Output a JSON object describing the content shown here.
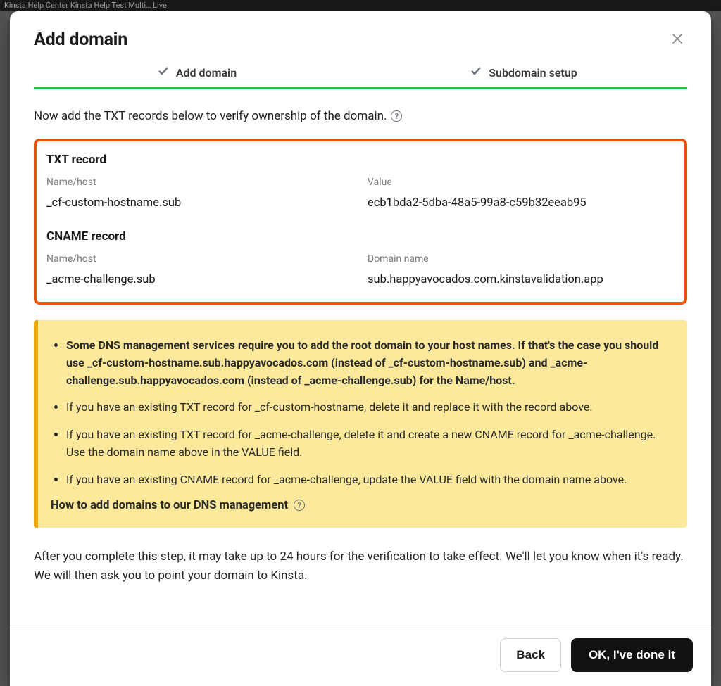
{
  "browser_tab_hint": "Kinsta Help Center     Kinsta Help Test Multi…     Live",
  "modal": {
    "title": "Add domain",
    "steps": [
      {
        "label": "Add domain"
      },
      {
        "label": "Subdomain setup"
      }
    ],
    "intro": "Now add the TXT records below to verify ownership of the domain.",
    "records": {
      "txt": {
        "title": "TXT record",
        "name_label": "Name/host",
        "name_value": "_cf-custom-hostname.sub",
        "value_label": "Value",
        "value_value": "ecb1bda2-5dba-48a5-99a8-c59b32eeab95"
      },
      "cname": {
        "title": "CNAME record",
        "name_label": "Name/host",
        "name_value": "_acme-challenge.sub",
        "value_label": "Domain name",
        "value_value": "sub.happyavocados.com.kinstavalidation.app"
      }
    },
    "notice": {
      "bold_item": {
        "a": "Some DNS management services require you to add the root domain to your host names. If that's the case you should use ",
        "b": "_cf-custom-hostname.sub.happyavocados.com",
        "c": " (instead of _cf-custom-hostname.sub) and ",
        "d": "_acme-challenge.sub.happyavocados.com",
        "e": " (instead of _acme-challenge.sub) for the Name/host."
      },
      "items": [
        "If you have an existing TXT record for _cf-custom-hostname, delete it and replace it with the record above.",
        "If you have an existing TXT record for _acme-challenge, delete it and create a new CNAME record for _acme-challenge. Use the domain name above in the VALUE field.",
        "If you have an existing CNAME record for _acme-challenge, update the VALUE field with the domain name above."
      ],
      "link": "How to add domains to our DNS management"
    },
    "after": "After you complete this step, it may take up to 24 hours for the verification to take effect. We'll let you know when it's ready. We will then ask you to point your domain to Kinsta.",
    "footer": {
      "back": "Back",
      "done": "OK, I've done it"
    }
  }
}
